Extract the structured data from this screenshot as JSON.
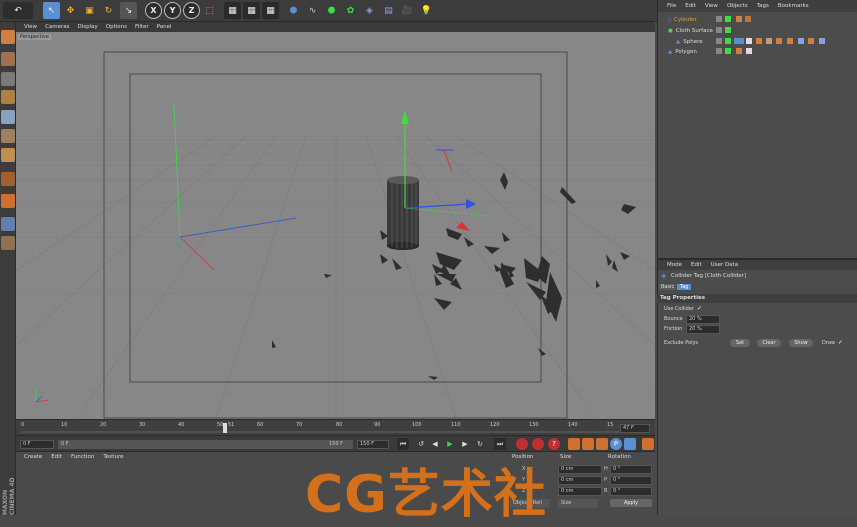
{
  "viewport_menu": [
    "View",
    "Cameras",
    "Display",
    "Options",
    "Filter",
    "Panel"
  ],
  "viewport_label": "Perspective",
  "timeline": {
    "ticks": [
      "0",
      "10",
      "20",
      "30",
      "40",
      "50",
      "51",
      "60",
      "70",
      "80",
      "90",
      "100",
      "110",
      "120",
      "130",
      "140",
      "15"
    ],
    "current_frame_display": "47 F",
    "start_field": "0 F",
    "start_field2": "0 F",
    "end_field": "150 F",
    "end_field2": "150 F"
  },
  "material_menu": [
    "Create",
    "Edit",
    "Function",
    "Texture"
  ],
  "coords": {
    "headers": [
      "Position",
      "Size",
      "Rotation"
    ],
    "rows": [
      {
        "axis": "X",
        "size": "0 cm",
        "rot_label": "H",
        "rot": "0 °"
      },
      {
        "axis": "Y",
        "size": "0 cm",
        "rot_label": "P",
        "rot": "0 °"
      },
      {
        "axis": "Z",
        "size": "0 cm",
        "rot_label": "B",
        "rot": "0 °"
      }
    ],
    "mode_select": "Object (Rel)",
    "size_select": "Size",
    "apply_label": "Apply"
  },
  "object_manager": {
    "menu": [
      "File",
      "Edit",
      "View",
      "Objects",
      "Tags",
      "Bookmarks"
    ],
    "objects": [
      {
        "name": "Cylinder",
        "color": "#e8a040"
      },
      {
        "name": "Cloth Surface",
        "color": "#dddddd"
      },
      {
        "name": "Sphere",
        "color": "#dddddd"
      },
      {
        "name": "Polygon",
        "color": "#dddddd"
      }
    ]
  },
  "attributes": {
    "menu": [
      "Mode",
      "Edit",
      "User Data"
    ],
    "title": "Collider Tag [Cloth Collider]",
    "tabs": [
      "Basic",
      "Tag"
    ],
    "section": "Tag Properties",
    "use_collider_label": "Use Collider",
    "use_collider_check": "✓",
    "bounce_label": "Bounce",
    "bounce_value": "20 %",
    "friction_label": "Friction",
    "friction_value": "20 %",
    "exclude_label": "Exclude Polys",
    "set_label": "Set",
    "clear_label": "Clear",
    "show_label": "Show",
    "draw_label": "Draw",
    "draw_check": "✓"
  },
  "watermark": "CG艺术社",
  "logo_text": "MAXON CINEMA 4D",
  "colors": {
    "accent_blue": "#5a8fd0",
    "axis_green": "#3ddc4a",
    "axis_red": "#e03030",
    "axis_blue": "#3050e0",
    "watermark": "#e07418"
  }
}
